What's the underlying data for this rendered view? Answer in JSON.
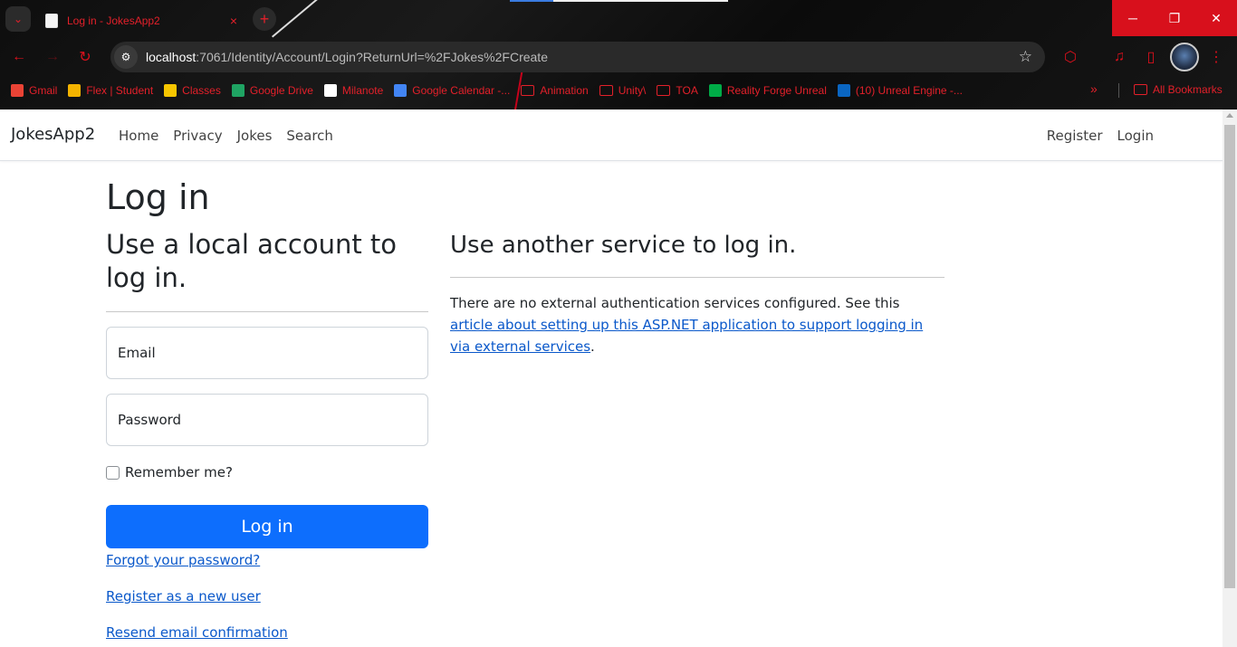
{
  "browser": {
    "tab_title": "Log in - JokesApp2",
    "tab_close": "×",
    "new_tab": "+",
    "url_host": "localhost",
    "url_rest": ":7061/Identity/Account/Login?ReturnUrl=%2FJokes%2FCreate",
    "window_controls": {
      "minimize": "─",
      "restore": "❐",
      "close": "✕"
    },
    "bookmarks": [
      {
        "label": "Gmail",
        "icon": "gmail-icon"
      },
      {
        "label": "Flex | Student",
        "icon": "flex-icon"
      },
      {
        "label": "Classes",
        "icon": "classroom-icon"
      },
      {
        "label": "Google Drive",
        "icon": "drive-icon"
      },
      {
        "label": "Milanote",
        "icon": "milanote-icon"
      },
      {
        "label": "Google Calendar -...",
        "icon": "calendar-icon"
      },
      {
        "label": "Animation",
        "icon": "folder-icon"
      },
      {
        "label": "Unity\\",
        "icon": "folder-icon"
      },
      {
        "label": "TOA",
        "icon": "folder-icon"
      },
      {
        "label": "Reality Forge Unreal",
        "icon": "meet-icon"
      },
      {
        "label": "(10) Unreal Engine -...",
        "icon": "linkedin-icon"
      }
    ],
    "bookmarks_more": "»",
    "all_bookmarks": "All Bookmarks",
    "accent_color": "#e3202a"
  },
  "navbar": {
    "brand": "JokesApp2",
    "links": [
      "Home",
      "Privacy",
      "Jokes",
      "Search"
    ],
    "register": "Register",
    "login": "Login"
  },
  "login": {
    "heading": "Log in",
    "local_heading": "Use a local account to log in.",
    "email_label": "Email",
    "password_label": "Password",
    "remember_label": "Remember me?",
    "submit_label": "Log in",
    "forgot_link": "Forgot your password?",
    "register_link": "Register as a new user",
    "resend_link": "Resend email confirmation"
  },
  "external": {
    "heading": "Use another service to log in.",
    "text_before": "There are no external authentication services configured. See this ",
    "link_text": "article about setting up this ASP.NET application to support logging in via external services",
    "text_after": "."
  },
  "colors": {
    "primary_button": "#0d6efd",
    "link": "#0a58ca"
  }
}
